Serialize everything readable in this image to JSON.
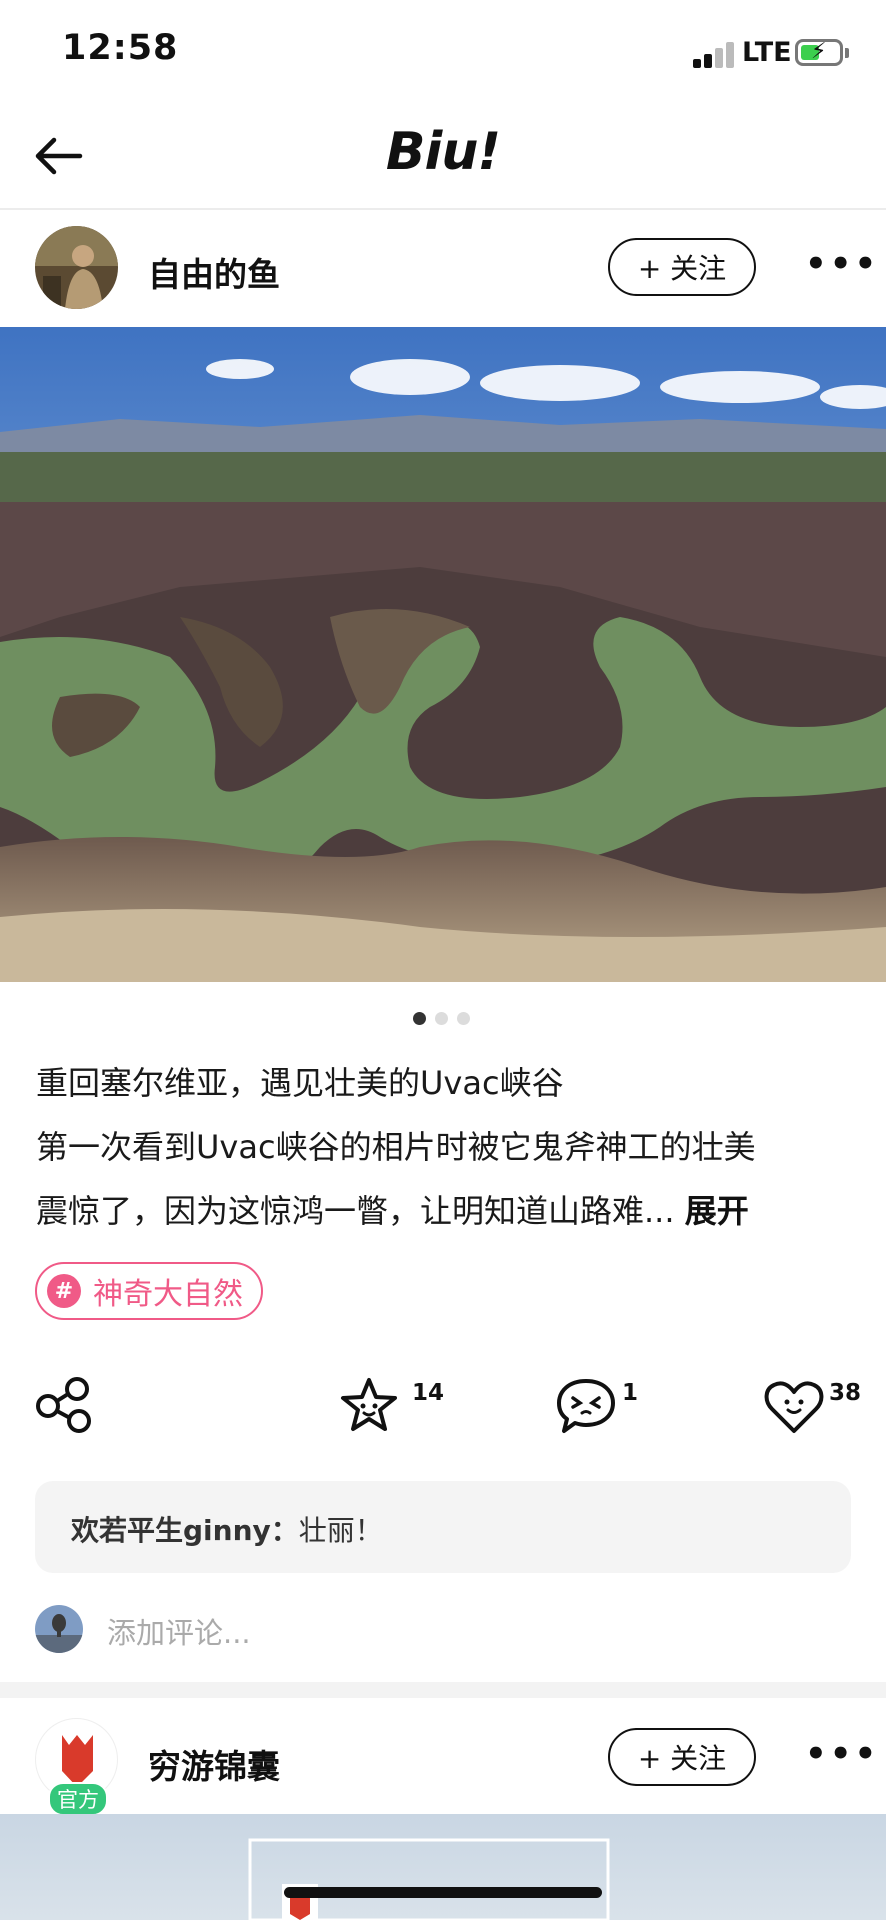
{
  "status_bar": {
    "time": "12:58",
    "network": "LTE"
  },
  "nav": {
    "brand": "Biu!"
  },
  "post1": {
    "username": "自由的鱼",
    "follow_label": "+ 关注",
    "title": "重回塞尔维亚，遇见壮美的Uvac峡谷",
    "body_line1": "第一次看到Uvac峡谷的相片时被它鬼斧神工的壮美",
    "body_line2": "震惊了，因为这惊鸿一瞥，让明知道山路难...",
    "expand_label": "展开",
    "tag": "神奇大自然",
    "tag_icon": "#",
    "actions": {
      "collect_count": "14",
      "comment_count": "1",
      "like_count": "38"
    },
    "comment": {
      "author": "欢若平生ginny：",
      "text": "壮丽！"
    },
    "add_comment_placeholder": "添加评论..."
  },
  "post2": {
    "username": "穷游锦囊",
    "badge": "官方",
    "follow_label": "+ 关注"
  },
  "colors": {
    "accent_pink": "#f05a87",
    "official_green": "#34c77b",
    "battery_green": "#3ccf4e"
  }
}
